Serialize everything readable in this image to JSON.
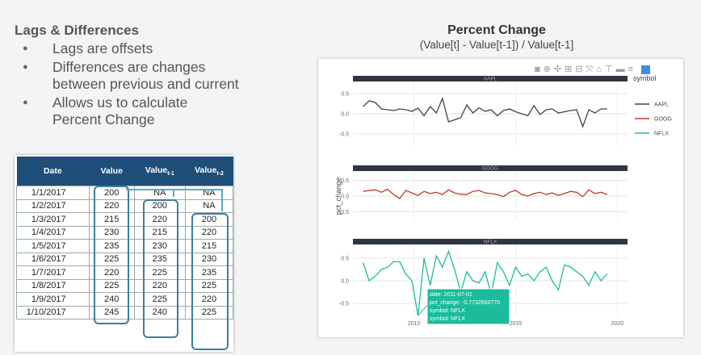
{
  "left": {
    "title": "Lags & Differences",
    "bullets": [
      {
        "line1": "Lags are offsets",
        "line2": ""
      },
      {
        "line1": "Differences are changes",
        "line2": "between previous and current"
      },
      {
        "line1": "Allows us to calculate",
        "line2": "Percent Change"
      }
    ]
  },
  "table": {
    "headers": [
      "Date",
      "Value",
      "Value",
      "Value"
    ],
    "subscripts": [
      "",
      "",
      "t-1",
      "t-2"
    ],
    "rows": [
      [
        "1/1/2017",
        "200",
        "NA",
        "NA"
      ],
      [
        "1/2/2017",
        "220",
        "200",
        "NA"
      ],
      [
        "1/3/2017",
        "215",
        "220",
        "200"
      ],
      [
        "1/4/2017",
        "230",
        "215",
        "220"
      ],
      [
        "1/5/2017",
        "235",
        "230",
        "215"
      ],
      [
        "1/6/2017",
        "225",
        "235",
        "230"
      ],
      [
        "1/7/2017",
        "220",
        "225",
        "235"
      ],
      [
        "1/8/2017",
        "225",
        "220",
        "225"
      ],
      [
        "1/9/2017",
        "240",
        "225",
        "220"
      ],
      [
        "1/10/2017",
        "245",
        "240",
        "225"
      ]
    ]
  },
  "right": {
    "title": "Percent Change",
    "formula": "(Value[t] - Value[t-1]) / Value[t-1]"
  },
  "chart_data": {
    "type": "line",
    "ylabel": "pct_change",
    "legend_title": "symbol",
    "legend_placement": "top-right",
    "xticks": [
      "2010",
      "2015",
      "2020"
    ],
    "yticks": [
      "0.5",
      "0.0",
      "-0.5"
    ],
    "xlim": [
      2007,
      2020.5
    ],
    "ylim": [
      -0.8,
      0.8
    ],
    "colors": {
      "AAPL": "#444444",
      "GOOG": "#c0392b",
      "NFLX": "#1abc9c"
    },
    "x": [
      2007.5,
      2007.8,
      2008.1,
      2008.4,
      2008.7,
      2009.0,
      2009.3,
      2009.6,
      2009.9,
      2010.2,
      2010.5,
      2010.8,
      2011.1,
      2011.4,
      2011.7,
      2012.0,
      2012.3,
      2012.6,
      2012.9,
      2013.2,
      2013.5,
      2013.8,
      2014.1,
      2014.4,
      2014.7,
      2015.0,
      2015.3,
      2015.6,
      2015.9,
      2016.2,
      2016.5,
      2016.8,
      2017.1,
      2017.4,
      2017.7,
      2018.0,
      2018.3,
      2018.6,
      2018.9,
      2019.2,
      2019.5
    ],
    "series": [
      {
        "name": "AAPL",
        "values": [
          0.18,
          0.32,
          0.28,
          0.12,
          0.1,
          0.08,
          0.12,
          0.1,
          0.06,
          0.14,
          -0.05,
          0.18,
          0.02,
          0.38,
          -0.2,
          -0.15,
          -0.1,
          0.22,
          0.02,
          0.15,
          0.06,
          0.1,
          -0.05,
          0.08,
          0.12,
          0.05,
          0.0,
          -0.05,
          0.2,
          -0.02,
          0.1,
          0.12,
          0.02,
          0.05,
          0.08,
          0.1,
          -0.32,
          0.1,
          0.02,
          0.12,
          0.12
        ]
      },
      {
        "name": "GOOG",
        "values": [
          0.15,
          0.18,
          0.2,
          0.12,
          0.22,
          0.05,
          -0.08,
          0.18,
          0.1,
          0.02,
          0.15,
          0.08,
          0.12,
          0.05,
          0.2,
          0.1,
          0.06,
          0.05,
          0.15,
          0.18,
          0.1,
          0.08,
          0.05,
          -0.02,
          0.12,
          0.18,
          0.05,
          0.0,
          0.08,
          0.12,
          0.05,
          0.1,
          0.02,
          0.08,
          0.15,
          0.12,
          -0.02,
          0.2,
          0.08,
          0.12,
          0.05
        ]
      },
      {
        "name": "NFLX",
        "values": [
          0.4,
          0.0,
          0.1,
          0.25,
          0.3,
          0.42,
          0.42,
          0.15,
          0.0,
          -0.77,
          0.5,
          -0.1,
          0.55,
          0.3,
          0.65,
          0.25,
          -0.25,
          0.2,
          0.0,
          -0.05,
          0.2,
          -0.3,
          0.4,
          0.2,
          -0.1,
          0.3,
          0.1,
          0.15,
          0.0,
          0.2,
          0.3,
          0.0,
          -0.2,
          0.35,
          0.3,
          0.2,
          0.1,
          -0.1,
          0.2,
          0.0,
          0.15
        ]
      }
    ],
    "tooltip": {
      "line1": "date: 2011-07-01",
      "line2": "pct_change: -0.7732650770",
      "line3": "symbol: NFLX",
      "line4": "symbol: NFLX"
    },
    "tooltip_point_index": 9
  }
}
